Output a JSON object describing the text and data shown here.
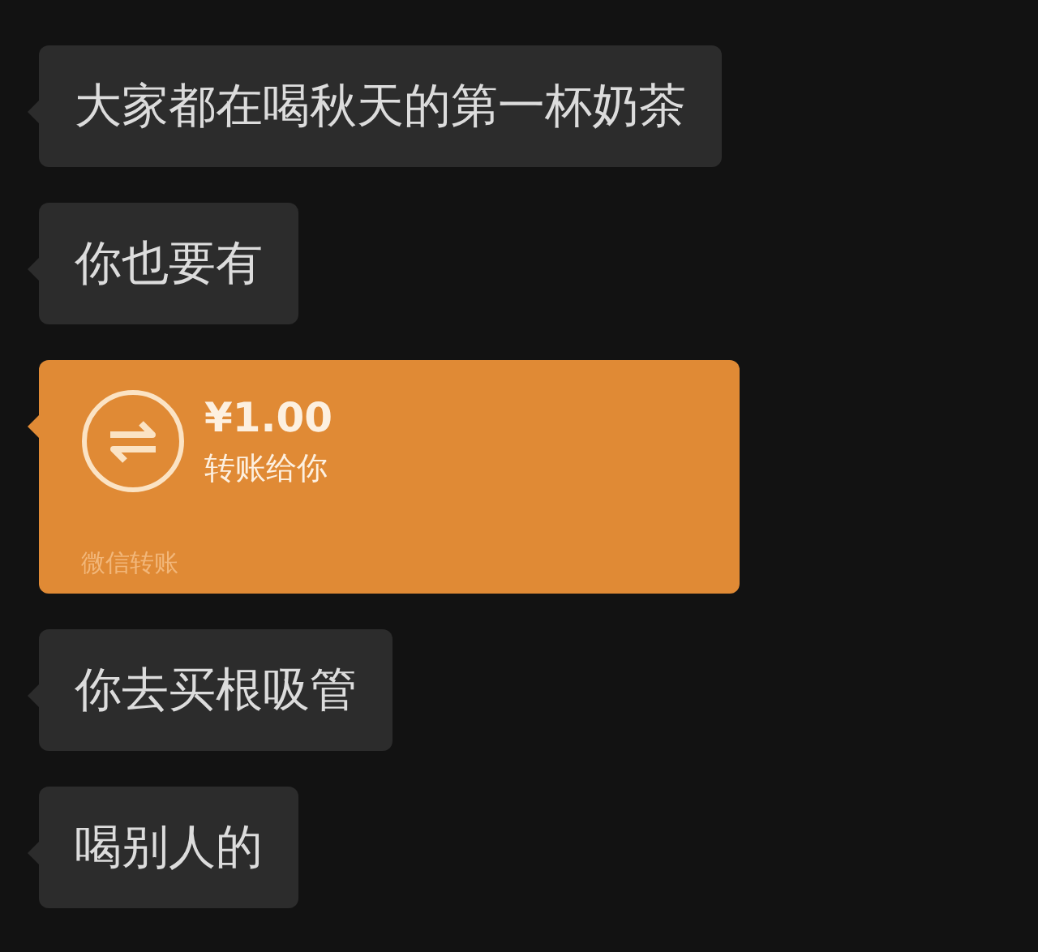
{
  "messages": [
    {
      "kind": "text",
      "text": "大家都在喝秋天的第一杯奶茶"
    },
    {
      "kind": "text",
      "text": "你也要有"
    },
    {
      "kind": "transfer",
      "amount": "¥1.00",
      "note": "转账给你",
      "footer": "微信转账"
    },
    {
      "kind": "text",
      "text": "你去买根吸管"
    },
    {
      "kind": "text",
      "text": "喝别人的"
    }
  ]
}
